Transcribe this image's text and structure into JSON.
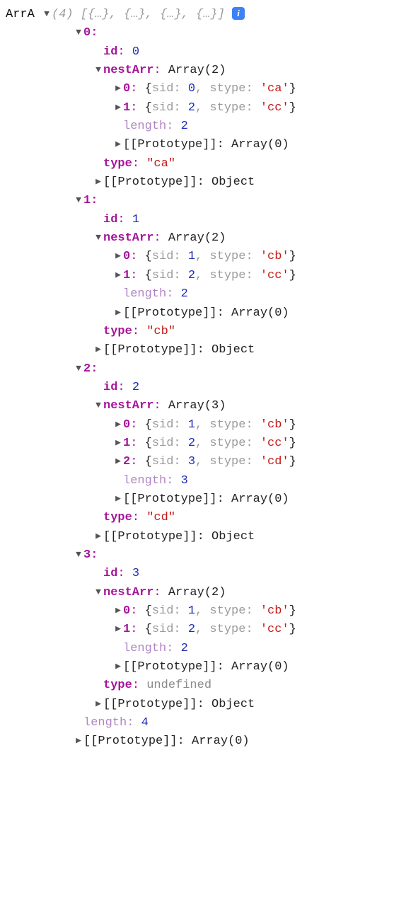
{
  "root": {
    "name": "ArrA",
    "count": "(4)",
    "preview": "[{…}, {…}, {…}, {…}]"
  },
  "protoArr": "[[Prototype]]: Array(0)",
  "protoObj": "[[Prototype]]: Object",
  "objTypeUndefined": "undefined",
  "outerLength": "4",
  "items": [
    {
      "idx": "0",
      "id": "0",
      "nestArrLabel": "Array(2)",
      "nest": [
        {
          "idx": "0",
          "sid": "0",
          "stype": "'ca'"
        },
        {
          "idx": "1",
          "sid": "2",
          "stype": "'cc'"
        }
      ],
      "nestLength": "2",
      "type": "\"ca\""
    },
    {
      "idx": "1",
      "id": "1",
      "nestArrLabel": "Array(2)",
      "nest": [
        {
          "idx": "0",
          "sid": "1",
          "stype": "'cb'"
        },
        {
          "idx": "1",
          "sid": "2",
          "stype": "'cc'"
        }
      ],
      "nestLength": "2",
      "type": "\"cb\""
    },
    {
      "idx": "2",
      "id": "2",
      "nestArrLabel": "Array(3)",
      "nest": [
        {
          "idx": "0",
          "sid": "1",
          "stype": "'cb'"
        },
        {
          "idx": "1",
          "sid": "2",
          "stype": "'cc'"
        },
        {
          "idx": "2",
          "sid": "3",
          "stype": "'cd'"
        }
      ],
      "nestLength": "3",
      "type": "\"cd\""
    },
    {
      "idx": "3",
      "id": "3",
      "nestArrLabel": "Array(2)",
      "nest": [
        {
          "idx": "0",
          "sid": "1",
          "stype": "'cb'"
        },
        {
          "idx": "1",
          "sid": "2",
          "stype": "'cc'"
        }
      ],
      "nestLength": "2",
      "type": null
    }
  ]
}
